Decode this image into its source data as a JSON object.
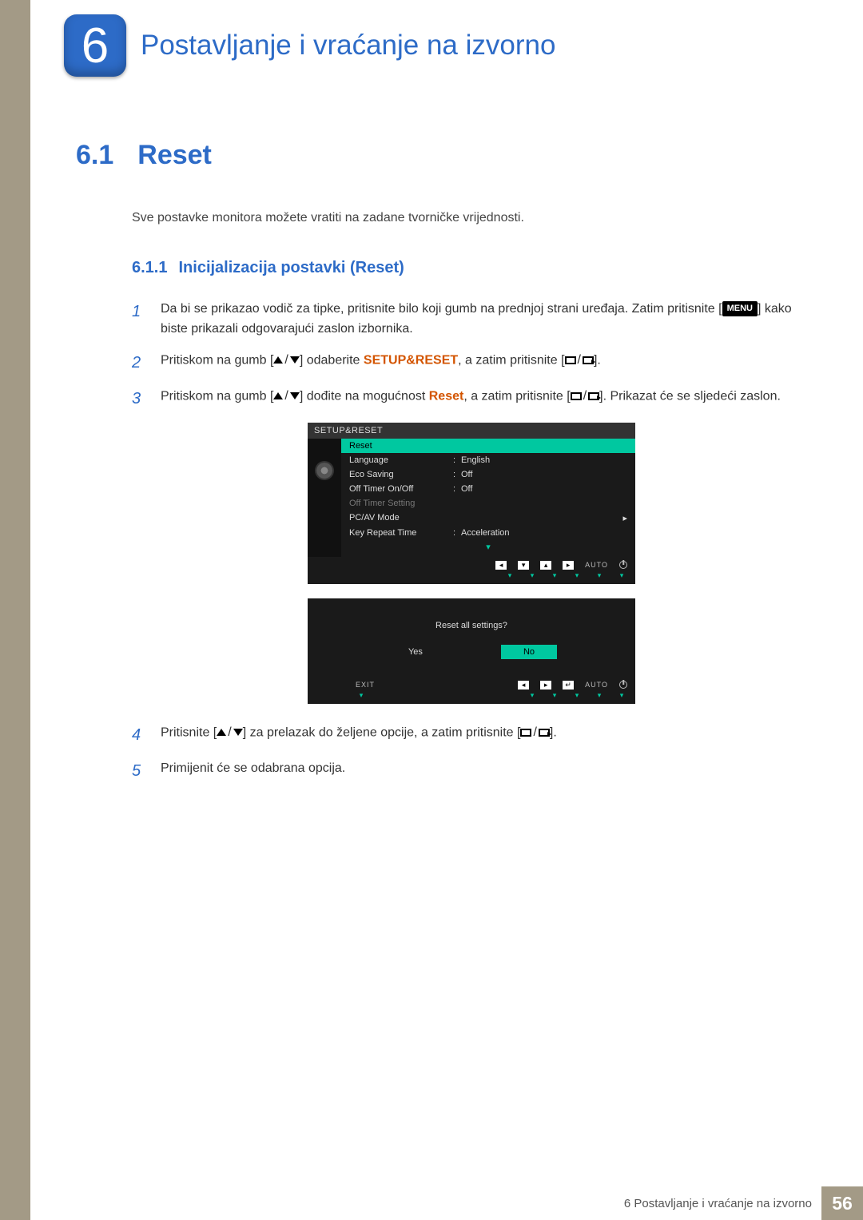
{
  "chapter": {
    "number": "6",
    "title": "Postavljanje i vraćanje na izvorno"
  },
  "section": {
    "number": "6.1",
    "title": "Reset",
    "intro": "Sve postavke monitora možete vratiti na zadane tvorničke vrijednosti."
  },
  "subsection": {
    "number": "6.1.1",
    "title": "Inicijalizacija postavki (Reset)"
  },
  "steps": {
    "s1_a": "Da bi se prikazao vodič za tipke, pritisnite bilo koji gumb na prednjoj strani uređaja. Zatim pritisnite [",
    "s1_menu": "MENU",
    "s1_b": "] kako biste prikazali odgovarajući zaslon izbornika.",
    "s2_a": "Pritiskom na gumb [",
    "s2_b": "] odaberite ",
    "s2_setup": "SETUP&RESET",
    "s2_c": ", a zatim pritisnite [",
    "s2_d": "].",
    "s3_a": "Pritiskom na gumb [",
    "s3_b": "] dođite na mogućnost ",
    "s3_reset": "Reset",
    "s3_c": ", a zatim pritisnite [",
    "s3_d": "]. Prikazat će se sljedeći zaslon.",
    "s4_a": "Pritisnite [",
    "s4_b": "] za prelazak do željene opcije, a zatim pritisnite [",
    "s4_c": "].",
    "s5": "Primijenit će se odabrana opcija."
  },
  "osd1": {
    "title": "SETUP&RESET",
    "items": [
      {
        "label": "Reset",
        "value": "",
        "sel": true
      },
      {
        "label": "Language",
        "value": "English"
      },
      {
        "label": "Eco Saving",
        "value": "Off"
      },
      {
        "label": "Off Timer On/Off",
        "value": "Off"
      },
      {
        "label": "Off Timer Setting",
        "value": "",
        "dim": true
      },
      {
        "label": "PC/AV Mode",
        "value": "",
        "chev": true
      },
      {
        "label": "Key Repeat Time",
        "value": "Acceleration"
      }
    ],
    "nav_auto": "AUTO"
  },
  "osd2": {
    "question": "Reset all settings?",
    "yes": "Yes",
    "no": "No",
    "exit": "EXIT",
    "nav_auto": "AUTO"
  },
  "footer": {
    "text": "6 Postavljanje i vraćanje na izvorno",
    "page": "56"
  }
}
